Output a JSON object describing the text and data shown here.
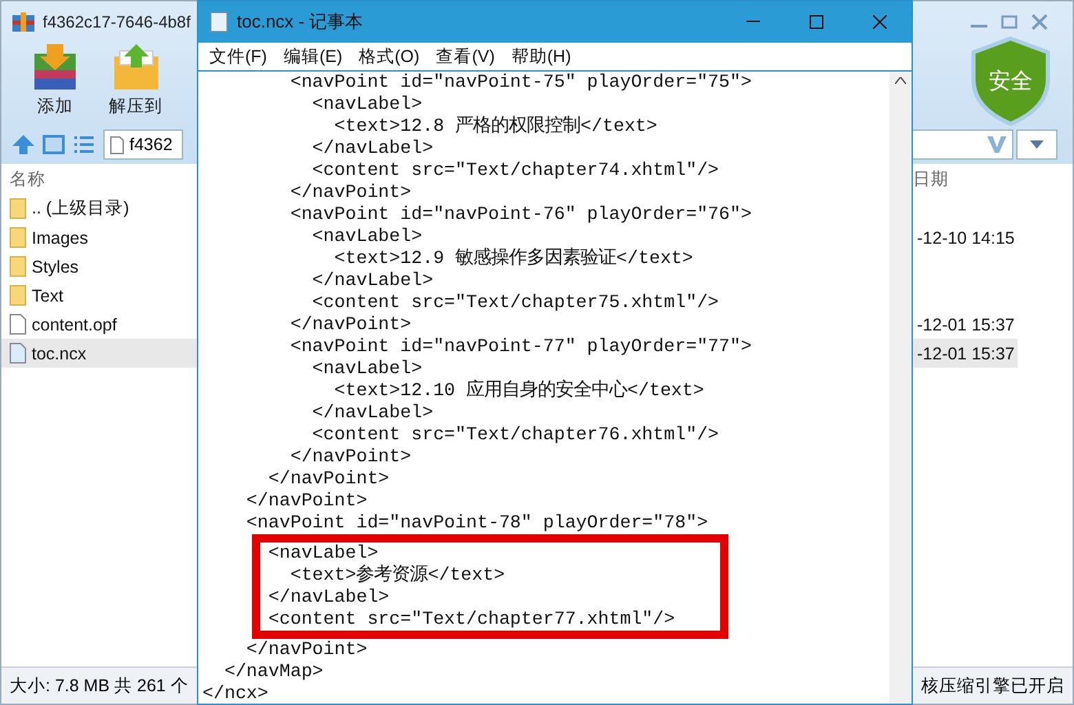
{
  "archive": {
    "title": "f4362c17-7646-4b8f",
    "toolbar": [
      {
        "kind": "add",
        "label": "添加"
      },
      {
        "kind": "extract",
        "label": "解压到"
      }
    ],
    "address": "f4362",
    "badge": "安全",
    "columns": [
      "名称",
      "日期"
    ],
    "rows": [
      {
        "kind": "folder",
        "name": ".. (上级目录)",
        "selected": false
      },
      {
        "kind": "folder",
        "name": "Images",
        "date": "-12-10 14:15",
        "selected": false
      },
      {
        "kind": "folder",
        "name": "Styles",
        "selected": false
      },
      {
        "kind": "folder",
        "name": "Text",
        "selected": false
      },
      {
        "kind": "file",
        "name": "content.opf",
        "date": "-12-01 15:37",
        "selected": false
      },
      {
        "kind": "file",
        "name": "toc.ncx",
        "date": "-12-01 15:37",
        "selected": true
      }
    ],
    "status_left": "大小: 7.8 MB 共 261 个",
    "status_right": "核压缩引擎已开启"
  },
  "notepad": {
    "title": "toc.ncx - 记事本",
    "menu": [
      "文件(F)",
      "编辑(E)",
      "格式(O)",
      "查看(V)",
      "帮助(H)"
    ],
    "lines_before": [
      "        <navPoint id=\"navPoint-75\" playOrder=\"75\">",
      "          <navLabel>",
      "            <text>12.8 严格的权限控制</text>",
      "          </navLabel>",
      "          <content src=\"Text/chapter74.xhtml\"/>",
      "        </navPoint>",
      "        <navPoint id=\"navPoint-76\" playOrder=\"76\">",
      "          <navLabel>",
      "            <text>12.9 敏感操作多因素验证</text>",
      "          </navLabel>",
      "          <content src=\"Text/chapter75.xhtml\"/>",
      "        </navPoint>",
      "        <navPoint id=\"navPoint-77\" playOrder=\"77\">",
      "          <navLabel>",
      "            <text>12.10 应用自身的安全中心</text>",
      "          </navLabel>",
      "          <content src=\"Text/chapter76.xhtml\"/>",
      "        </navPoint>",
      "      </navPoint>",
      "    </navPoint>",
      "    <navPoint id=\"navPoint-78\" playOrder=\"78\">"
    ],
    "highlighted_lines": [
      "      <navLabel>",
      "        <text>参考资源</text>",
      "      </navLabel>",
      "      <content src=\"Text/chapter77.xhtml\"/>"
    ],
    "lines_after": [
      "    </navPoint>",
      "  </navMap>",
      "</ncx>"
    ]
  }
}
